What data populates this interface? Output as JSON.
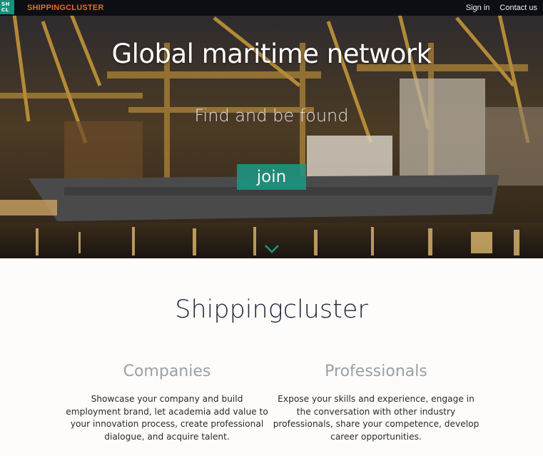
{
  "header": {
    "logo_line1": "SH",
    "logo_line2": "CL",
    "brand": "SHIPPINGCLUSTER",
    "nav": [
      "Sign in",
      "Contact us"
    ]
  },
  "hero": {
    "title": "Global maritime network",
    "subtitle": "Find and be found",
    "join_label": "join",
    "scroll_icon": "chevron-down-icon"
  },
  "main": {
    "title": "Shippingcluster",
    "columns": [
      {
        "heading": "Companies",
        "text": "Showcase your company and build employment brand, let academia add value to your innovation process, create professional dialogue, and acquire talent."
      },
      {
        "heading": "Professionals",
        "text": "Expose your skills and experience, engage in the conversation with other industry professionals, share your competence, develop career opportunities."
      }
    ]
  },
  "colors": {
    "brand_orange": "#e8692c",
    "accent_teal": "#1a9682",
    "logo_teal": "#1a8f7e",
    "heading_dark": "#22253a",
    "heading_gray": "#9aa0a6"
  }
}
